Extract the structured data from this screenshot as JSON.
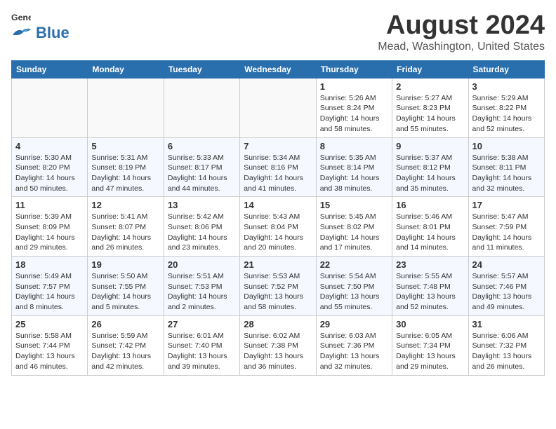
{
  "header": {
    "logo_line1": "General",
    "logo_line2": "Blue",
    "title": "August 2024",
    "subtitle": "Mead, Washington, United States"
  },
  "days_of_week": [
    "Sunday",
    "Monday",
    "Tuesday",
    "Wednesday",
    "Thursday",
    "Friday",
    "Saturday"
  ],
  "weeks": [
    [
      {
        "day": "",
        "info": ""
      },
      {
        "day": "",
        "info": ""
      },
      {
        "day": "",
        "info": ""
      },
      {
        "day": "",
        "info": ""
      },
      {
        "day": "1",
        "info": "Sunrise: 5:26 AM\nSunset: 8:24 PM\nDaylight: 14 hours\nand 58 minutes."
      },
      {
        "day": "2",
        "info": "Sunrise: 5:27 AM\nSunset: 8:23 PM\nDaylight: 14 hours\nand 55 minutes."
      },
      {
        "day": "3",
        "info": "Sunrise: 5:29 AM\nSunset: 8:22 PM\nDaylight: 14 hours\nand 52 minutes."
      }
    ],
    [
      {
        "day": "4",
        "info": "Sunrise: 5:30 AM\nSunset: 8:20 PM\nDaylight: 14 hours\nand 50 minutes."
      },
      {
        "day": "5",
        "info": "Sunrise: 5:31 AM\nSunset: 8:19 PM\nDaylight: 14 hours\nand 47 minutes."
      },
      {
        "day": "6",
        "info": "Sunrise: 5:33 AM\nSunset: 8:17 PM\nDaylight: 14 hours\nand 44 minutes."
      },
      {
        "day": "7",
        "info": "Sunrise: 5:34 AM\nSunset: 8:16 PM\nDaylight: 14 hours\nand 41 minutes."
      },
      {
        "day": "8",
        "info": "Sunrise: 5:35 AM\nSunset: 8:14 PM\nDaylight: 14 hours\nand 38 minutes."
      },
      {
        "day": "9",
        "info": "Sunrise: 5:37 AM\nSunset: 8:12 PM\nDaylight: 14 hours\nand 35 minutes."
      },
      {
        "day": "10",
        "info": "Sunrise: 5:38 AM\nSunset: 8:11 PM\nDaylight: 14 hours\nand 32 minutes."
      }
    ],
    [
      {
        "day": "11",
        "info": "Sunrise: 5:39 AM\nSunset: 8:09 PM\nDaylight: 14 hours\nand 29 minutes."
      },
      {
        "day": "12",
        "info": "Sunrise: 5:41 AM\nSunset: 8:07 PM\nDaylight: 14 hours\nand 26 minutes."
      },
      {
        "day": "13",
        "info": "Sunrise: 5:42 AM\nSunset: 8:06 PM\nDaylight: 14 hours\nand 23 minutes."
      },
      {
        "day": "14",
        "info": "Sunrise: 5:43 AM\nSunset: 8:04 PM\nDaylight: 14 hours\nand 20 minutes."
      },
      {
        "day": "15",
        "info": "Sunrise: 5:45 AM\nSunset: 8:02 PM\nDaylight: 14 hours\nand 17 minutes."
      },
      {
        "day": "16",
        "info": "Sunrise: 5:46 AM\nSunset: 8:01 PM\nDaylight: 14 hours\nand 14 minutes."
      },
      {
        "day": "17",
        "info": "Sunrise: 5:47 AM\nSunset: 7:59 PM\nDaylight: 14 hours\nand 11 minutes."
      }
    ],
    [
      {
        "day": "18",
        "info": "Sunrise: 5:49 AM\nSunset: 7:57 PM\nDaylight: 14 hours\nand 8 minutes."
      },
      {
        "day": "19",
        "info": "Sunrise: 5:50 AM\nSunset: 7:55 PM\nDaylight: 14 hours\nand 5 minutes."
      },
      {
        "day": "20",
        "info": "Sunrise: 5:51 AM\nSunset: 7:53 PM\nDaylight: 14 hours\nand 2 minutes."
      },
      {
        "day": "21",
        "info": "Sunrise: 5:53 AM\nSunset: 7:52 PM\nDaylight: 13 hours\nand 58 minutes."
      },
      {
        "day": "22",
        "info": "Sunrise: 5:54 AM\nSunset: 7:50 PM\nDaylight: 13 hours\nand 55 minutes."
      },
      {
        "day": "23",
        "info": "Sunrise: 5:55 AM\nSunset: 7:48 PM\nDaylight: 13 hours\nand 52 minutes."
      },
      {
        "day": "24",
        "info": "Sunrise: 5:57 AM\nSunset: 7:46 PM\nDaylight: 13 hours\nand 49 minutes."
      }
    ],
    [
      {
        "day": "25",
        "info": "Sunrise: 5:58 AM\nSunset: 7:44 PM\nDaylight: 13 hours\nand 46 minutes."
      },
      {
        "day": "26",
        "info": "Sunrise: 5:59 AM\nSunset: 7:42 PM\nDaylight: 13 hours\nand 42 minutes."
      },
      {
        "day": "27",
        "info": "Sunrise: 6:01 AM\nSunset: 7:40 PM\nDaylight: 13 hours\nand 39 minutes."
      },
      {
        "day": "28",
        "info": "Sunrise: 6:02 AM\nSunset: 7:38 PM\nDaylight: 13 hours\nand 36 minutes."
      },
      {
        "day": "29",
        "info": "Sunrise: 6:03 AM\nSunset: 7:36 PM\nDaylight: 13 hours\nand 32 minutes."
      },
      {
        "day": "30",
        "info": "Sunrise: 6:05 AM\nSunset: 7:34 PM\nDaylight: 13 hours\nand 29 minutes."
      },
      {
        "day": "31",
        "info": "Sunrise: 6:06 AM\nSunset: 7:32 PM\nDaylight: 13 hours\nand 26 minutes."
      }
    ]
  ]
}
